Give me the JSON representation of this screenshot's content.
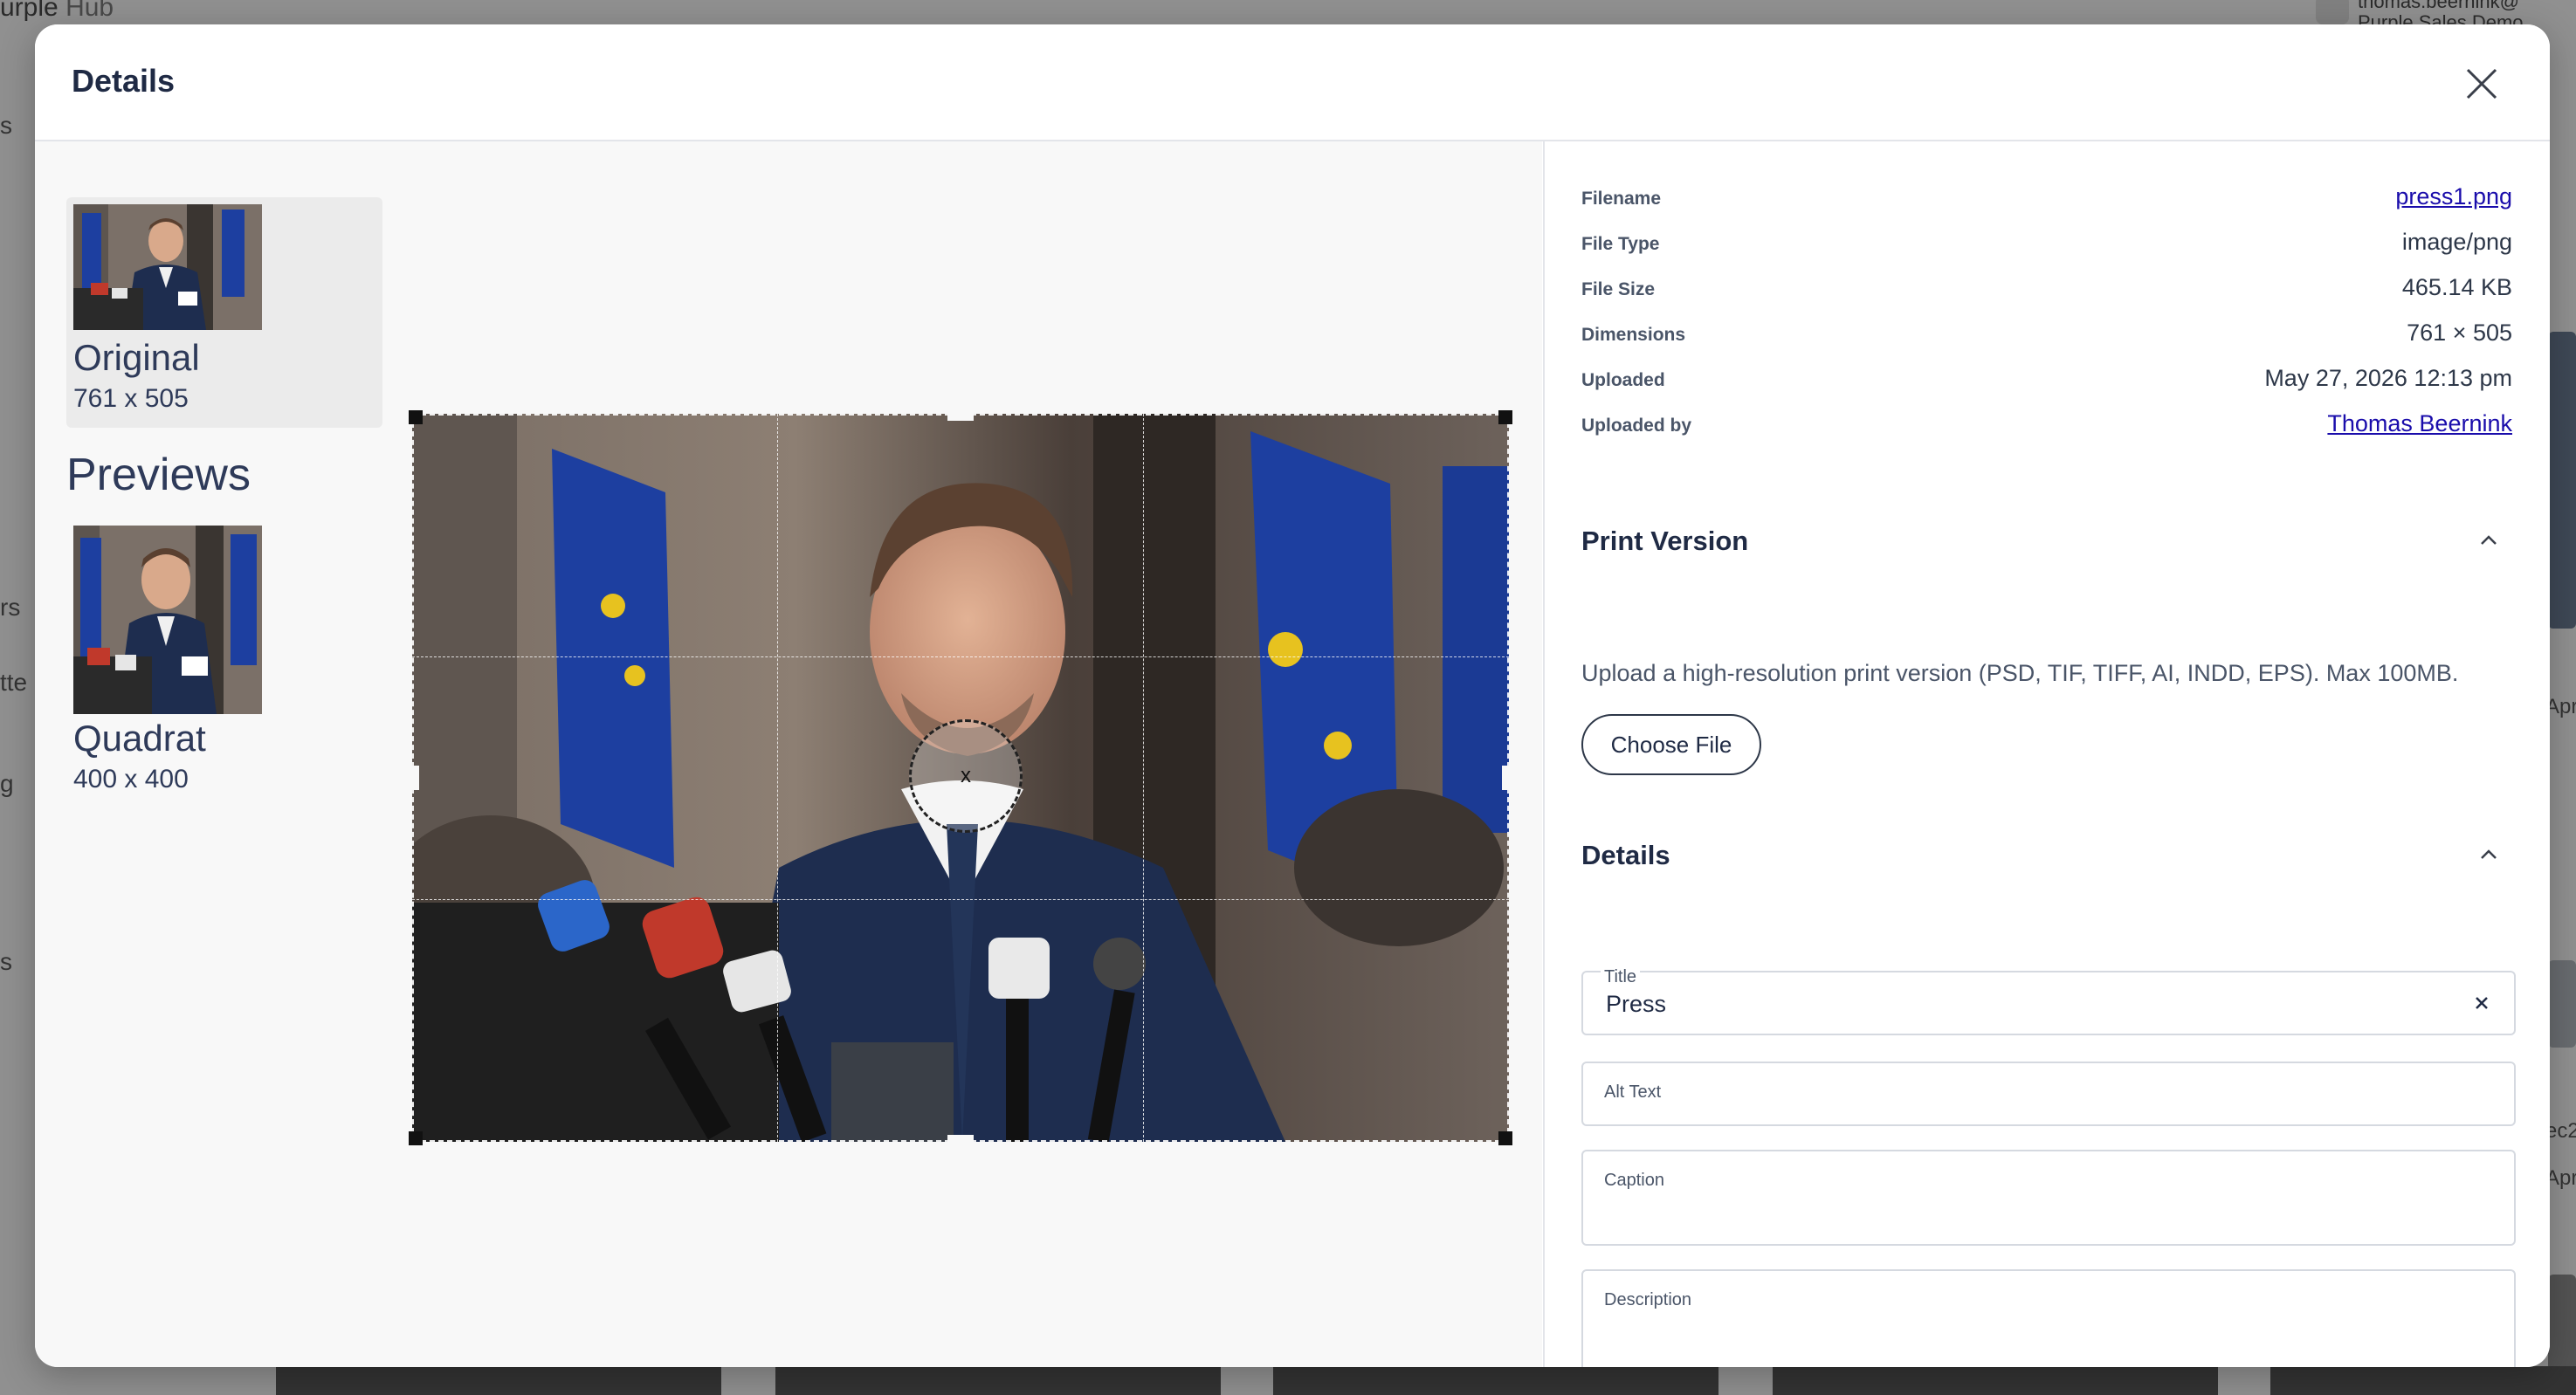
{
  "background": {
    "brand_prefix": "urple",
    "brand_suffix": "Hub",
    "user_line1": "thomas.beernink@",
    "user_line2": "Purple Sales Demo",
    "side_fragments": [
      "s",
      "rs",
      "tte",
      "g",
      "s"
    ],
    "right_fragments": [
      "Apr",
      "ec2",
      "Apr"
    ]
  },
  "modal": {
    "title": "Details",
    "close_icon": "close-icon"
  },
  "variants": {
    "original": {
      "name": "Original",
      "dimensions": "761 x 505"
    },
    "previews_heading": "Previews",
    "previews": [
      {
        "name": "Quadrat",
        "dimensions": "400 x 400"
      }
    ]
  },
  "cropper": {
    "center_label": "x",
    "image_description_icon": "press-conference-photo"
  },
  "file_info": {
    "filename_label": "Filename",
    "filename_value": "press1.png",
    "filetype_label": "File Type",
    "filetype_value": "image/png",
    "filesize_label": "File Size",
    "filesize_value": "465.14 KB",
    "dimensions_label": "Dimensions",
    "dimensions_value": "761 × 505",
    "uploaded_label": "Uploaded",
    "uploaded_value": "May 27, 2026 12:13 pm",
    "uploaded_by_label": "Uploaded by",
    "uploaded_by_value": "Thomas Beernink"
  },
  "print_version": {
    "title": "Print Version",
    "hint": "Upload a high-resolution print version (PSD, TIF, TIFF, AI, INDD, EPS). Max 100MB.",
    "choose_file_label": "Choose File"
  },
  "details": {
    "title": "Details",
    "title_field_label": "Title",
    "title_field_value": "Press",
    "alt_text_label": "Alt Text",
    "alt_text_value": "",
    "caption_label": "Caption",
    "caption_value": "",
    "description_label": "Description",
    "description_value": ""
  },
  "colors": {
    "accent_link": "#1a0dab",
    "heading": "#1f2a44",
    "flag_blue": "#1d3fa0",
    "suit_navy": "#1e2d4f"
  }
}
